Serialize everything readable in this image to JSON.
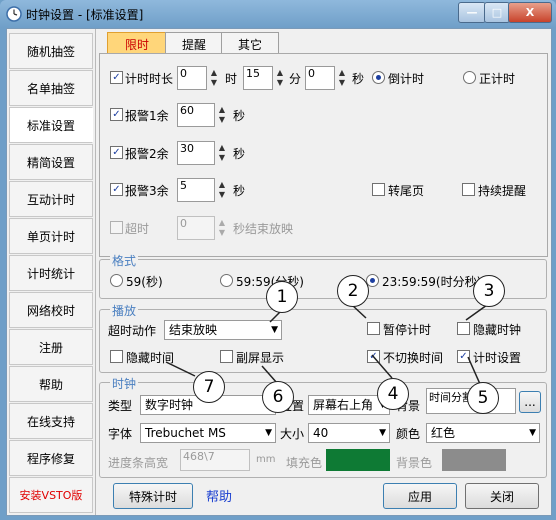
{
  "window": {
    "title": "时钟设置 - [标准设置]",
    "minimize": "—",
    "maximize": "□",
    "close": "X"
  },
  "sidebar": {
    "items": [
      {
        "label": "随机抽签"
      },
      {
        "label": "名单抽签"
      },
      {
        "label": "标准设置"
      },
      {
        "label": "精简设置"
      },
      {
        "label": "互动计时"
      },
      {
        "label": "单页计时"
      },
      {
        "label": "计时统计"
      },
      {
        "label": "网络校时"
      },
      {
        "label": "注册"
      },
      {
        "label": "帮助"
      },
      {
        "label": "在线支持"
      },
      {
        "label": "程序修复"
      },
      {
        "label": "安装VSTO版"
      }
    ]
  },
  "tabs": [
    {
      "label": "限时"
    },
    {
      "label": "提醒"
    },
    {
      "label": "其它"
    }
  ],
  "limit": {
    "timer_label": "计时时长",
    "hours": "0",
    "hours_unit": "时",
    "minutes": "15",
    "minutes_unit": "分",
    "seconds": "0",
    "seconds_unit": "秒",
    "countdown": "倒计时",
    "countup": "正计时",
    "alarm1_label": "报警1余",
    "alarm1_value": "60",
    "alarm1_unit": "秒",
    "alarm2_label": "报警2余",
    "alarm2_value": "30",
    "alarm2_unit": "秒",
    "alarm3_label": "报警3余",
    "alarm3_value": "5",
    "alarm3_unit": "秒",
    "turn_last_page": "转尾页",
    "continuous_alert": "持续提醒",
    "overtime_label": "超时",
    "overtime_value": "0",
    "overtime_text": "秒结束放映"
  },
  "format": {
    "title": "格式",
    "opt1": "59(秒)",
    "opt2": "59:59(分秒)",
    "opt3": "23:59:59(时分秒)"
  },
  "playback": {
    "title": "播放",
    "timeout_action_label": "超时动作",
    "timeout_action_value": "结束放映",
    "pause_timing": "暂停计时",
    "hide_clock": "隐藏时钟",
    "hide_time": "隐藏时间",
    "secondary_screen": "副屏显示",
    "no_switch_time": "不切换时间",
    "timer_settings": "计时设置"
  },
  "clock": {
    "title": "时钟",
    "type_label": "类型",
    "type_value": "数字时钟",
    "position_label": "位置",
    "position_value": "屏幕右上角",
    "background_label": "背景",
    "background_value": "时间分割5示i",
    "browse": "...",
    "font_label": "字体",
    "font_value": "Trebuchet MS",
    "size_label": "大小",
    "size_value": "40",
    "color_label": "颜色",
    "color_value": "红色",
    "progress_label": "进度条高宽",
    "progress_value": "468\\7",
    "progress_unit": "mm",
    "fill_label": "填充色",
    "bg_color_label": "背景色",
    "fill_color": "#0e7a34",
    "bg_color": "#8c8c8c"
  },
  "bottom": {
    "special_timer": "特殊计时",
    "help": "帮助",
    "apply": "应用",
    "close": "关闭"
  },
  "callouts": [
    "1",
    "2",
    "3",
    "4",
    "5",
    "6",
    "7"
  ]
}
